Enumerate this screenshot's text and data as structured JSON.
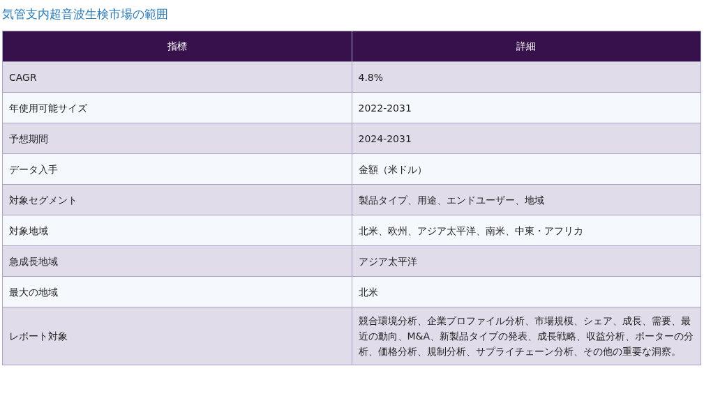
{
  "title": "気管支内超音波生検市場の範囲",
  "table": {
    "columns": [
      "指標",
      "詳細"
    ],
    "rows": [
      [
        "CAGR",
        "4.8%"
      ],
      [
        "年使用可能サイズ",
        "2022-2031"
      ],
      [
        "予想期間",
        "2024-2031"
      ],
      [
        "データ入手",
        "金額（米ドル）"
      ],
      [
        "対象セグメント",
        "製品タイプ、用途、エンドユーザー、地域"
      ],
      [
        "対象地域",
        "北米、欧州、アジア太平洋、南米、中東・アフリカ"
      ],
      [
        "急成長地域",
        "アジア太平洋"
      ],
      [
        "最大の地域",
        "北米"
      ],
      [
        "レポート対象",
        "競合環境分析、企業プロファイル分析、市場規模、シェア、成長、需要、最近の動向、M&A、新製品タイプの発表、成長戦略、収益分析、ポーターの分析、価格分析、規制分析、サプライチェーン分析、その他の重要な洞察。"
      ]
    ]
  }
}
